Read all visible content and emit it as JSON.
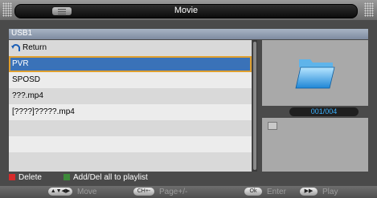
{
  "window": {
    "title": "Movie"
  },
  "header": {
    "source": "USB1"
  },
  "file_list": {
    "items": [
      {
        "label": "Return",
        "icon": "return-arrow-icon"
      },
      {
        "label": "PVR",
        "selected": true
      },
      {
        "label": "SPOSD"
      },
      {
        "label": "???.mp4"
      },
      {
        "label": "[????]?????.mp4"
      }
    ]
  },
  "preview": {
    "counter": "001/004",
    "icon": "folder-icon"
  },
  "legend": {
    "delete_label": "Delete",
    "playlist_label": "Add/Del all to playlist",
    "delete_color": "#d62a2a",
    "playlist_color": "#3d8a3a"
  },
  "footer": {
    "move": {
      "key": "▲▼◀▶",
      "label": "Move"
    },
    "page": {
      "key": "CH+-",
      "label": "Page+/-"
    },
    "enter": {
      "key": "Ok",
      "label": "Enter"
    },
    "play": {
      "key": "▶▶",
      "label": "Play"
    }
  }
}
